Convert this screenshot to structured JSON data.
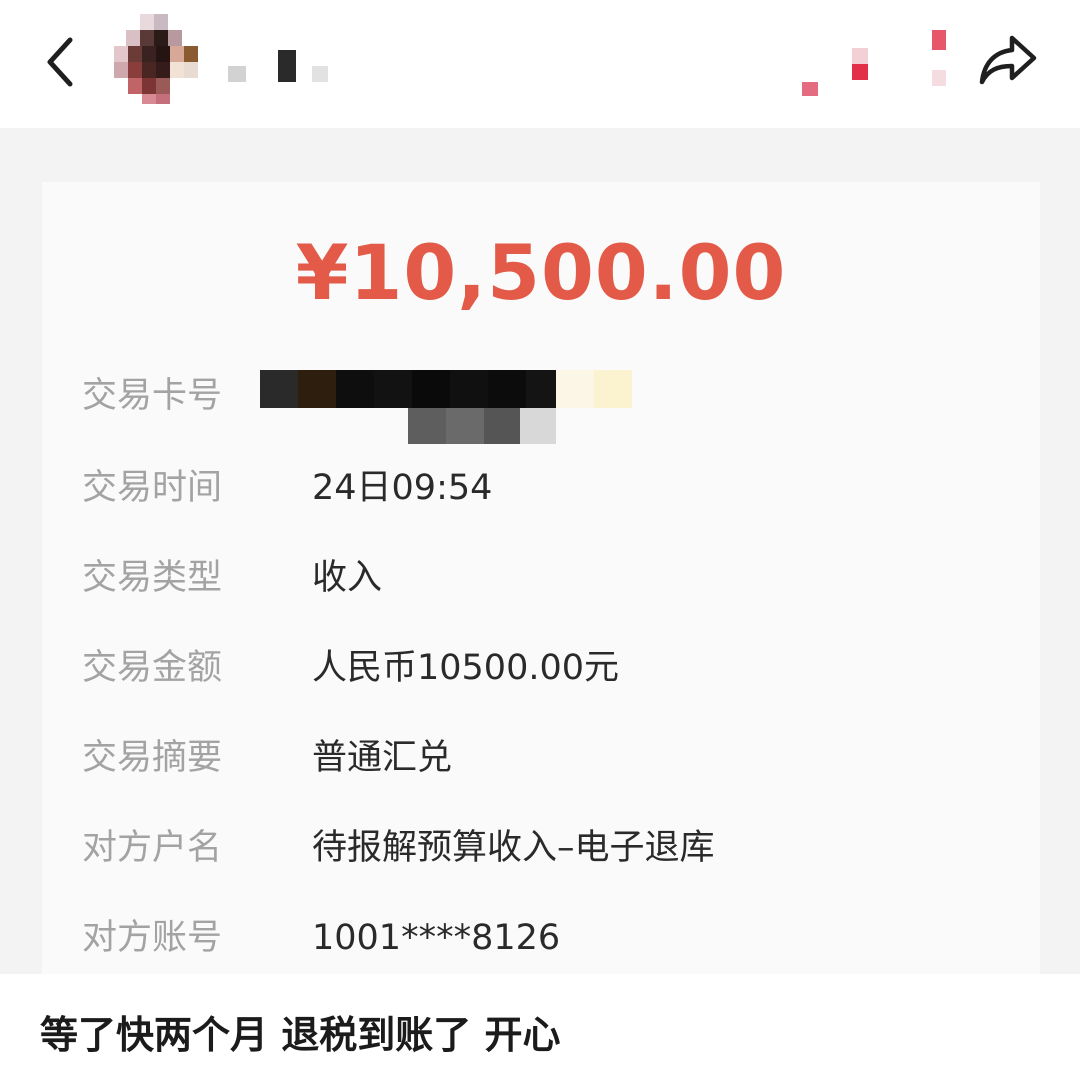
{
  "header": {
    "back_icon": "chevron-left-icon",
    "share_icon": "share-arrow-icon"
  },
  "receipt": {
    "amount": "¥10,500.00",
    "amount_color": "#e35a48",
    "rows": [
      {
        "label": "交易卡号",
        "value": ""
      },
      {
        "label": "交易时间",
        "value": "24日09:54"
      },
      {
        "label": "交易类型",
        "value": "收入"
      },
      {
        "label": "交易金额",
        "value": "人民币10500.00元"
      },
      {
        "label": "交易摘要",
        "value": "普通汇兑"
      },
      {
        "label": "对方户名",
        "value": "待报解预算收入–电子退库"
      },
      {
        "label": "对方账号",
        "value": "1001****8126"
      }
    ]
  },
  "post": {
    "caption": "等了快两个月 退税到账了 开心"
  }
}
